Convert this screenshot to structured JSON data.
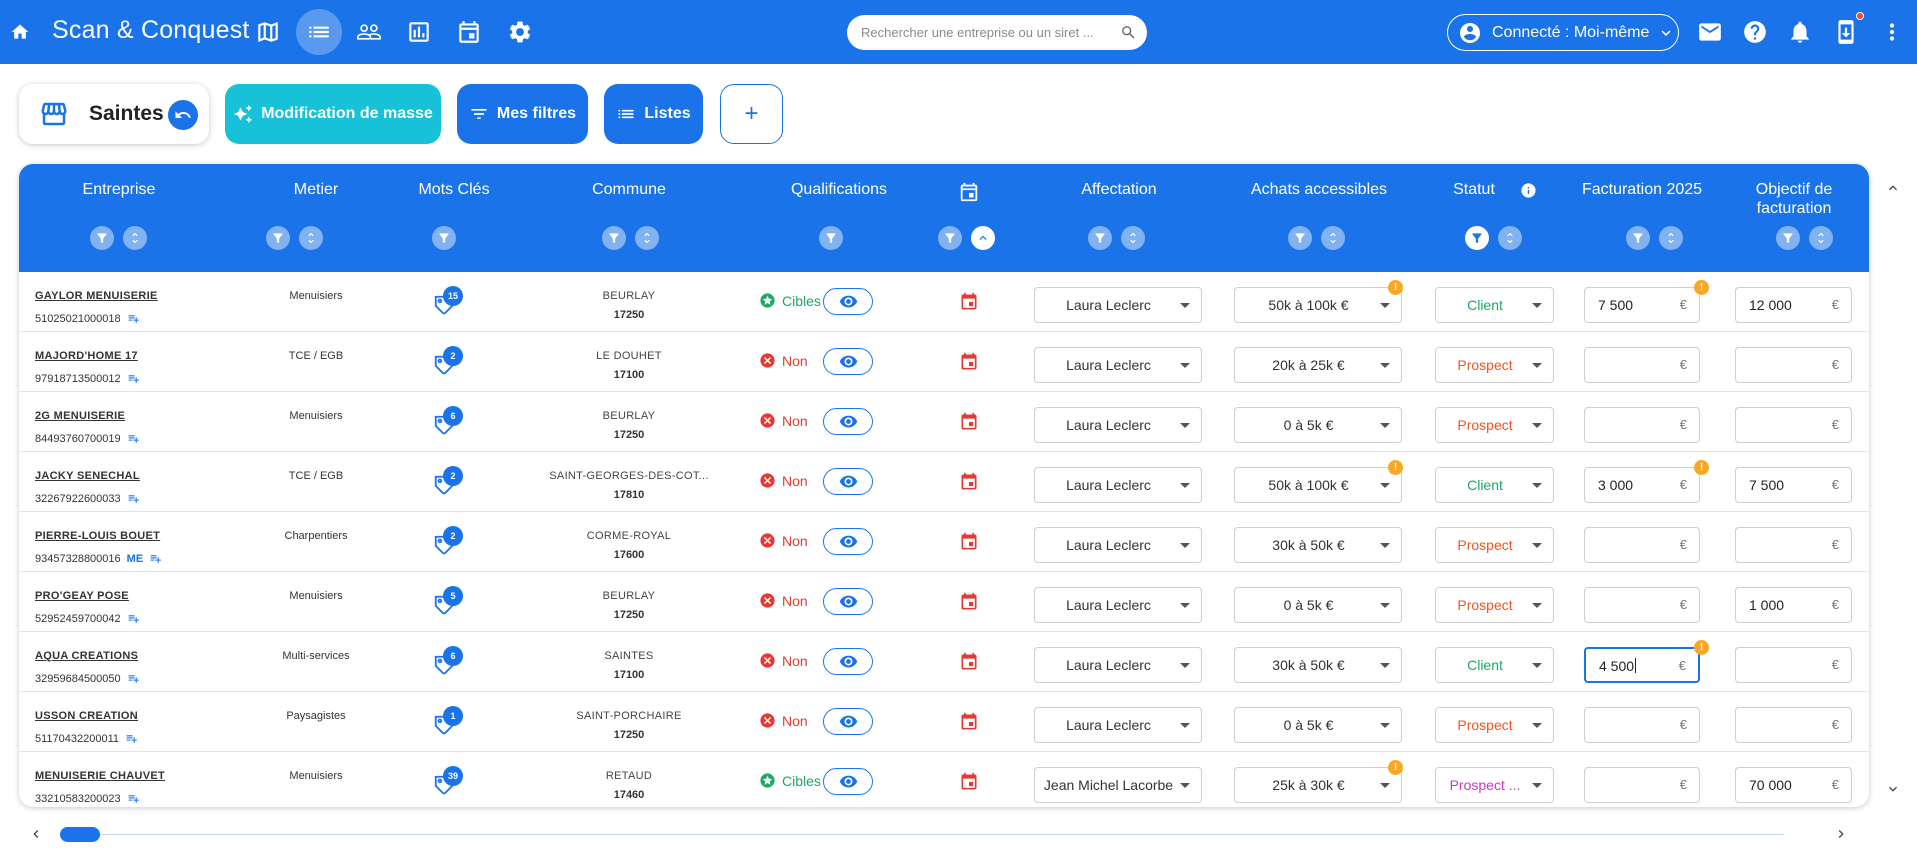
{
  "app": {
    "title": "Scan & Conquest"
  },
  "search": {
    "placeholder": "Rechercher une entreprise ou un siret ..."
  },
  "user": {
    "connected_label": "Connecté : Moi-même"
  },
  "toolbar": {
    "store_name": "Saintes",
    "bulk_edit_label": "Modification de masse",
    "filters_label": "Mes filtres",
    "lists_label": "Listes",
    "add_label": "+"
  },
  "columns": {
    "entreprise": "Entreprise",
    "metier": "Metier",
    "mots_cles": "Mots Clés",
    "commune": "Commune",
    "qualifications": "Qualifications",
    "affectation": "Affectation",
    "achats": "Achats accessibles",
    "statut": "Statut",
    "facturation": "Facturation 2025",
    "objectif": "Objectif de facturation"
  },
  "currency": "€",
  "rows": [
    {
      "name": "GAYLOR MENUISERIE",
      "siret": "51025021000018",
      "me": "",
      "metier": "Menuisiers",
      "tags": "15",
      "commune": "BEURLAY",
      "cp": "17250",
      "qual": "Cibles",
      "affectation": "Laura Leclerc",
      "achats": "50k à 100k €",
      "achats_warn": true,
      "statut": "Client",
      "facturation": "7 500",
      "fac_warn": true,
      "objectif": "12 000"
    },
    {
      "name": "MAJORD'HOME 17",
      "siret": "97918713500012",
      "me": "",
      "metier": "TCE / EGB",
      "tags": "2",
      "commune": "LE DOUHET",
      "cp": "17100",
      "qual": "Non",
      "affectation": "Laura Leclerc",
      "achats": "20k à 25k €",
      "achats_warn": false,
      "statut": "Prospect",
      "facturation": "",
      "fac_warn": false,
      "objectif": ""
    },
    {
      "name": "2G MENUISERIE",
      "siret": "84493760700019",
      "me": "",
      "metier": "Menuisiers",
      "tags": "6",
      "commune": "BEURLAY",
      "cp": "17250",
      "qual": "Non",
      "affectation": "Laura Leclerc",
      "achats": "0 à 5k €",
      "achats_warn": false,
      "statut": "Prospect",
      "facturation": "",
      "fac_warn": false,
      "objectif": ""
    },
    {
      "name": "JACKY SENECHAL",
      "siret": "32267922600033",
      "me": "",
      "metier": "TCE / EGB",
      "tags": "2",
      "commune": "SAINT-GEORGES-DES-COT...",
      "cp": "17810",
      "qual": "Non",
      "affectation": "Laura Leclerc",
      "achats": "50k à 100k €",
      "achats_warn": true,
      "statut": "Client",
      "facturation": "3 000",
      "fac_warn": true,
      "objectif": "7 500"
    },
    {
      "name": "PIERRE-LOUIS BOUET",
      "siret": "93457328800016",
      "me": "ME",
      "metier": "Charpentiers",
      "tags": "2",
      "commune": "CORME-ROYAL",
      "cp": "17600",
      "qual": "Non",
      "affectation": "Laura Leclerc",
      "achats": "30k à 50k €",
      "achats_warn": false,
      "statut": "Prospect",
      "facturation": "",
      "fac_warn": false,
      "objectif": ""
    },
    {
      "name": "PRO'GEAY POSE",
      "siret": "52952459700042",
      "me": "",
      "metier": "Menuisiers",
      "tags": "5",
      "commune": "BEURLAY",
      "cp": "17250",
      "qual": "Non",
      "affectation": "Laura Leclerc",
      "achats": "0 à 5k €",
      "achats_warn": false,
      "statut": "Prospect",
      "facturation": "",
      "fac_warn": false,
      "objectif": "1 000"
    },
    {
      "name": "AQUA CREATIONS",
      "siret": "32959684500050",
      "me": "",
      "metier": "Multi-services",
      "tags": "6",
      "commune": "SAINTES",
      "cp": "17100",
      "qual": "Non",
      "affectation": "Laura Leclerc",
      "achats": "30k à 50k €",
      "achats_warn": false,
      "statut": "Client",
      "facturation": "4 500",
      "fac_warn": true,
      "objectif": ""
    },
    {
      "name": "USSON CREATION",
      "siret": "51170432200011",
      "me": "",
      "metier": "Paysagistes",
      "tags": "1",
      "commune": "SAINT-PORCHAIRE",
      "cp": "17250",
      "qual": "Non",
      "affectation": "Laura Leclerc",
      "achats": "0 à 5k €",
      "achats_warn": false,
      "statut": "Prospect",
      "facturation": "",
      "fac_warn": false,
      "objectif": ""
    },
    {
      "name": "MENUISERIE CHAUVET",
      "siret": "33210583200023",
      "me": "",
      "metier": "Menuisiers",
      "tags": "39",
      "commune": "RETAUD",
      "cp": "17460",
      "qual": "Cibles",
      "affectation": "Jean Michel Lacorbe",
      "achats": "25k à 30k €",
      "achats_warn": true,
      "statut": "Prospect ...",
      "facturation": "",
      "fac_warn": false,
      "objectif": "70 000"
    }
  ],
  "colors": {
    "primary": "#1a73e8",
    "cyan": "#17c1d8",
    "client": "#1ea863",
    "prospect": "#f4511e",
    "prospect_other": "#c837c0",
    "warning": "#f9a825",
    "danger": "#e53935"
  }
}
